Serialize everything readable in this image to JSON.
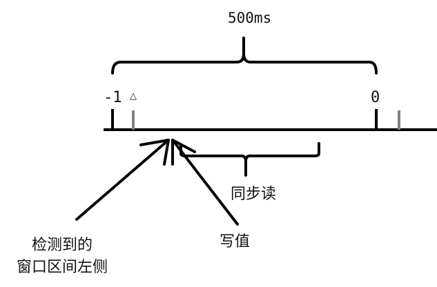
{
  "diagram": {
    "duration_label": "500ms",
    "tick_labels": [
      "-1",
      "0"
    ],
    "marker_symbol": "△",
    "sync_read_label": "同步读",
    "write_label": "写值",
    "detect_label_line1": "检测到的",
    "detect_label_line2": "窗口区间左侧",
    "colors": {
      "line": "#000000",
      "secondary_tick": "#808080"
    }
  }
}
